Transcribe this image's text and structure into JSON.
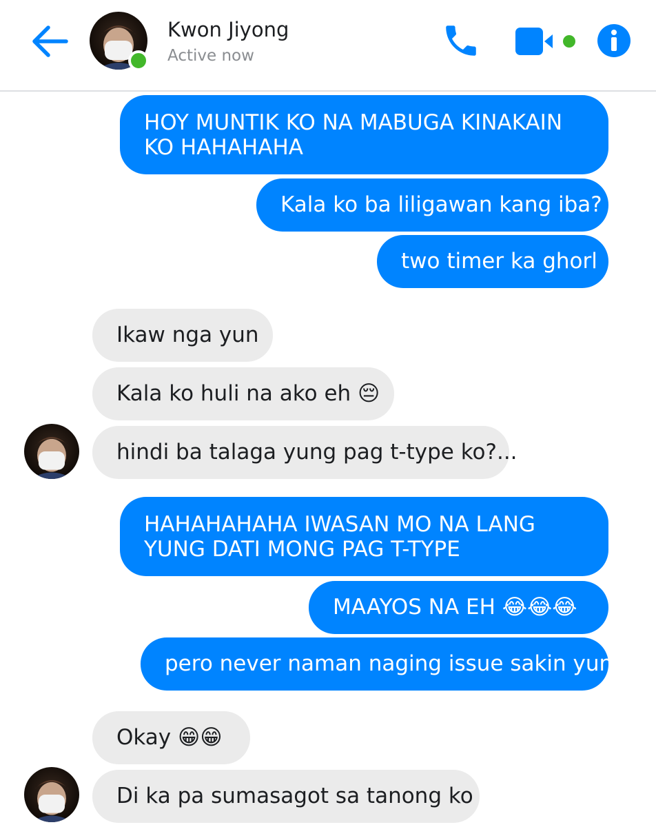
{
  "header": {
    "contact_name": "Kwon Jiyong",
    "status": "Active now",
    "back_icon": "arrow-left-icon",
    "call_icon": "phone-icon",
    "video_icon": "video-camera-icon",
    "info_icon": "info-icon"
  },
  "colors": {
    "accent": "#0084ff",
    "incoming_bubble": "#ebebeb",
    "presence": "#42b72a"
  },
  "messages": [
    {
      "from": "me",
      "text": "HOY MUNTIK KO NA MABUGA KINAKAIN KO HAHAHAHA"
    },
    {
      "from": "me",
      "text": "Kala ko ba liligawan kang iba?"
    },
    {
      "from": "me",
      "text": "two timer ka ghorl"
    },
    {
      "from": "them",
      "text": "Ikaw nga yun"
    },
    {
      "from": "them",
      "text": "Kala ko huli na ako eh 😔"
    },
    {
      "from": "them",
      "text": "hindi ba talaga yung pag t-type ko?..."
    },
    {
      "from": "me",
      "text": "HAHAHAHAHA IWASAN MO NA LANG YUNG DATI MONG PAG T-TYPE"
    },
    {
      "from": "me",
      "text": "MAAYOS NA EH 😂😂😂"
    },
    {
      "from": "me",
      "text": "pero never naman naging issue sakin yun"
    },
    {
      "from": "them",
      "text": "Okay 😁😁"
    },
    {
      "from": "them",
      "text": "Di ka pa sumasagot sa tanong ko"
    }
  ]
}
